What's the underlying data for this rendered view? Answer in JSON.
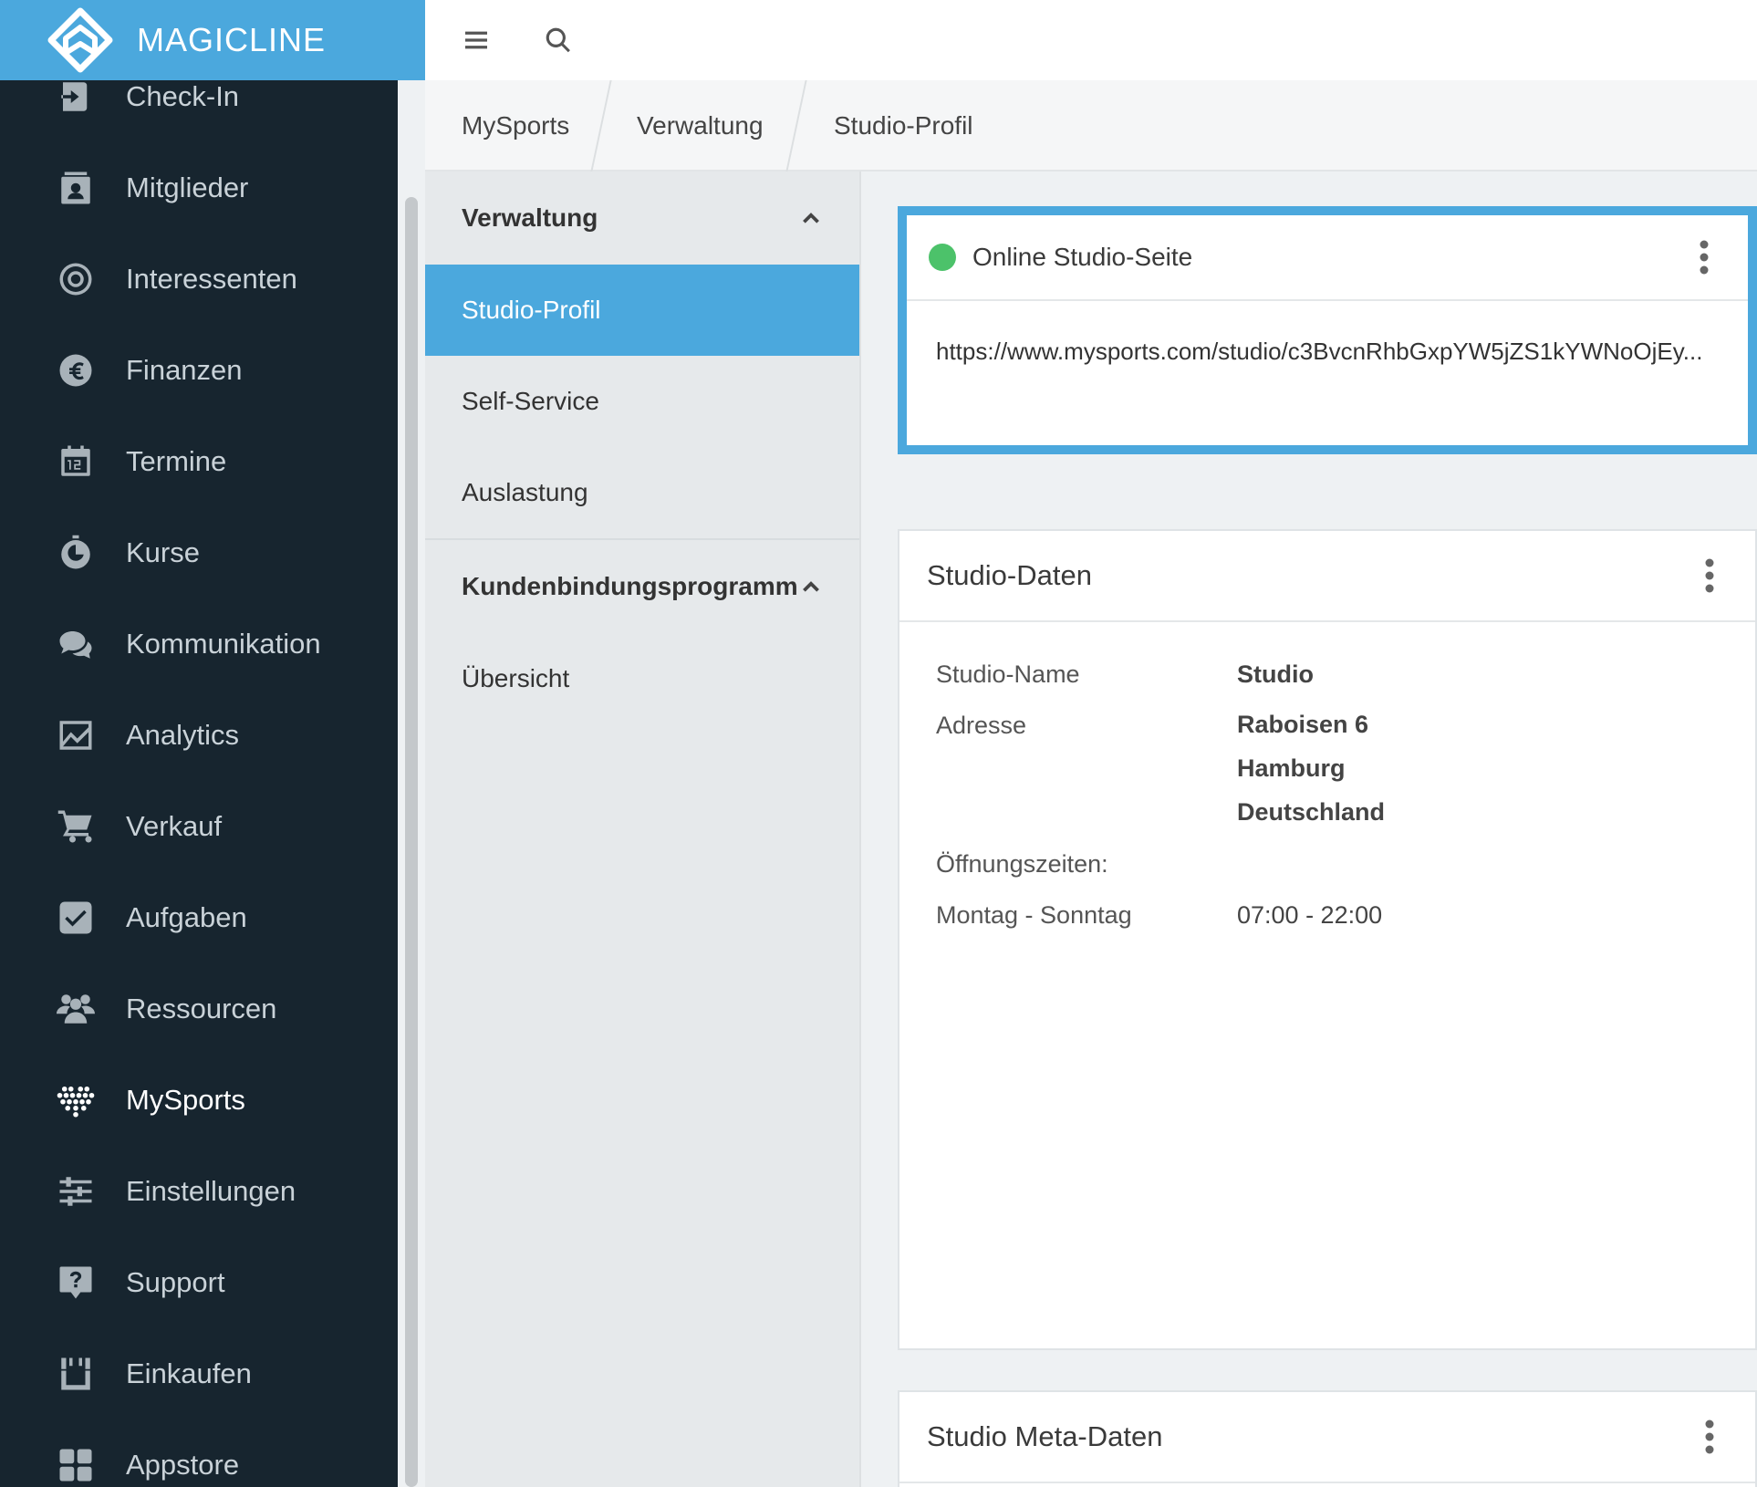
{
  "brand": {
    "name": "MAGICLINE"
  },
  "sidebar": {
    "items": [
      {
        "label": "Check-In",
        "icon": "check-in-icon"
      },
      {
        "label": "Mitglieder",
        "icon": "members-icon"
      },
      {
        "label": "Interessenten",
        "icon": "target-icon"
      },
      {
        "label": "Finanzen",
        "icon": "euro-icon"
      },
      {
        "label": "Termine",
        "icon": "calendar-icon"
      },
      {
        "label": "Kurse",
        "icon": "stopwatch-icon"
      },
      {
        "label": "Kommunikation",
        "icon": "chat-icon"
      },
      {
        "label": "Analytics",
        "icon": "chart-icon"
      },
      {
        "label": "Verkauf",
        "icon": "cart-icon"
      },
      {
        "label": "Aufgaben",
        "icon": "checkbox-icon"
      },
      {
        "label": "Ressourcen",
        "icon": "group-icon"
      },
      {
        "label": "MySports",
        "icon": "heart-dots-icon",
        "active": true
      },
      {
        "label": "Einstellungen",
        "icon": "sliders-icon"
      },
      {
        "label": "Support",
        "icon": "help-icon"
      },
      {
        "label": "Einkaufen",
        "icon": "shop-icon"
      },
      {
        "label": "Appstore",
        "icon": "apps-icon"
      }
    ]
  },
  "topbar": {
    "menu_icon": "hamburger-icon",
    "search_icon": "search-icon"
  },
  "breadcrumb": [
    "MySports",
    "Verwaltung",
    "Studio-Profil"
  ],
  "subnav": {
    "section1": {
      "title": "Verwaltung",
      "items": [
        "Studio-Profil",
        "Self-Service",
        "Auslastung"
      ],
      "active": "Studio-Profil"
    },
    "section2": {
      "title": "Kundenbindungsprogramm",
      "items": [
        "Übersicht"
      ]
    }
  },
  "online_card": {
    "title": "Online Studio-Seite",
    "status_color": "#4cc26a",
    "url": "https://www.mysports.com/studio/c3BvcnRhbGxpYW5jZS1kYWNoOjEy..."
  },
  "studio_data": {
    "title": "Studio-Daten",
    "name_label": "Studio-Name",
    "name_value": "Studio",
    "address_label": "Adresse",
    "address_lines": [
      "Raboisen 6",
      "Hamburg",
      "Deutschland"
    ],
    "hours_heading": "Öffnungszeiten:",
    "hours_days": "Montag - Sonntag",
    "hours_time": "07:00 - 22:00"
  },
  "meta_card": {
    "title": "Studio Meta-Daten"
  },
  "colors": {
    "accent": "#4ba8dd",
    "sidebar_bg": "#17252f",
    "online": "#4cc26a"
  }
}
